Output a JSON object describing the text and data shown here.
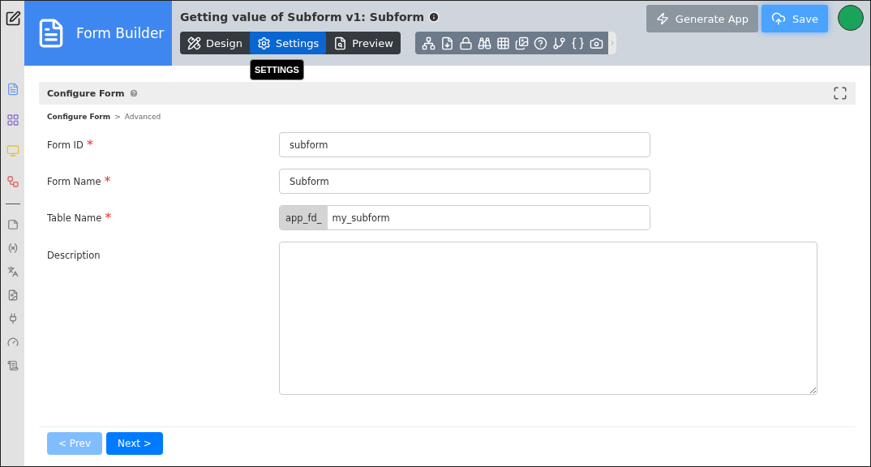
{
  "app": {
    "title": "Form Builder"
  },
  "header": {
    "title": "Getting value of Subform v1: Subform",
    "generate_button": "Generate App",
    "save_button": "Save"
  },
  "tabs": [
    {
      "label": "Design",
      "selected": false
    },
    {
      "label": "Settings",
      "selected": true
    },
    {
      "label": "Preview",
      "selected": false
    }
  ],
  "tooltip": "SETTINGS",
  "panel": {
    "title": "Configure Form",
    "breadcrumb": [
      "Configure Form",
      "Advanced"
    ],
    "breadcrumb_separator": ">"
  },
  "fields": [
    {
      "kind": "text",
      "label": "Form ID",
      "required_mark": "*",
      "value": "subform"
    },
    {
      "kind": "text",
      "label": "Form Name",
      "required_mark": "*",
      "value": "Subform"
    },
    {
      "kind": "prefixed",
      "label": "Table Name",
      "required_mark": "*",
      "prefix": "app_fd_",
      "value": "my_subform"
    },
    {
      "kind": "textarea",
      "label": "Description"
    }
  ],
  "nav_buttons": [
    {
      "label": "< Prev",
      "disabled": true
    },
    {
      "label": "Next >",
      "disabled": false
    }
  ]
}
